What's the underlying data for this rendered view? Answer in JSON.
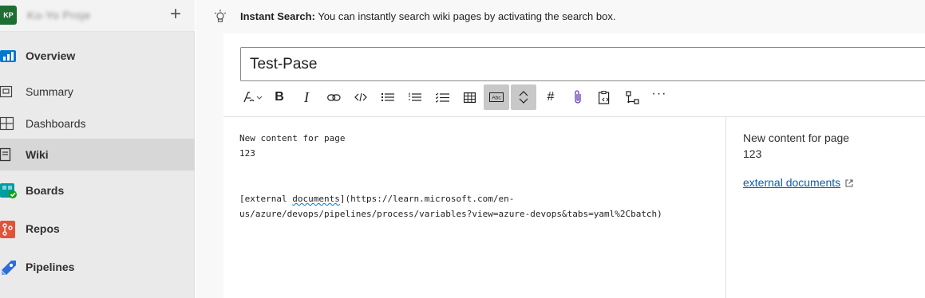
{
  "sidebar": {
    "avatar_initials": "KP",
    "project_name": "Ko-Yo Proje",
    "items": [
      {
        "label": "Overview",
        "icon": "overview-icon",
        "color": "#0078d4"
      },
      {
        "label": "Summary",
        "icon": "summary-icon"
      },
      {
        "label": "Dashboards",
        "icon": "dashboards-icon"
      },
      {
        "label": "Wiki",
        "icon": "wiki-icon"
      },
      {
        "label": "Boards",
        "icon": "boards-icon",
        "color": "#009ca0"
      },
      {
        "label": "Repos",
        "icon": "repos-icon",
        "color": "#e0543a"
      },
      {
        "label": "Pipelines",
        "icon": "pipelines-icon",
        "color": "#2d6dd8"
      }
    ],
    "active_item": "Wiki"
  },
  "banner": {
    "icon": "instant-search-icon",
    "title": "Instant Search:",
    "text": "You can instantly search wiki pages by activating the search box."
  },
  "editor": {
    "page_title": "Test-Pase",
    "toolbar": [
      "header-icon",
      "bold-icon",
      "italic-icon",
      "link-icon",
      "code-icon",
      "bulleted-list-icon",
      "numbered-list-icon",
      "checklist-icon",
      "table-icon",
      "spellcheck-icon",
      "toggle-preview-icon",
      "mention-icon",
      "attachment-icon",
      "paste-icon",
      "mermaid-diagram-icon",
      "more-icon"
    ],
    "source_line_1": "New content for page",
    "source_line_2": "123",
    "source_link_prefix": "[external ",
    "source_link_word": "documents",
    "source_link_rest_1": "](https://learn.microsoft.com/en-",
    "source_link_rest_2": "us/azure/devops/pipelines/process/variables?view=azure-devops&tabs=yaml%2Cbatch)"
  },
  "preview": {
    "line_1": "New content for page",
    "line_2": "123",
    "link_text": "external documents",
    "link_icon": "external-link-icon",
    "link_color": "#0b5cad"
  }
}
